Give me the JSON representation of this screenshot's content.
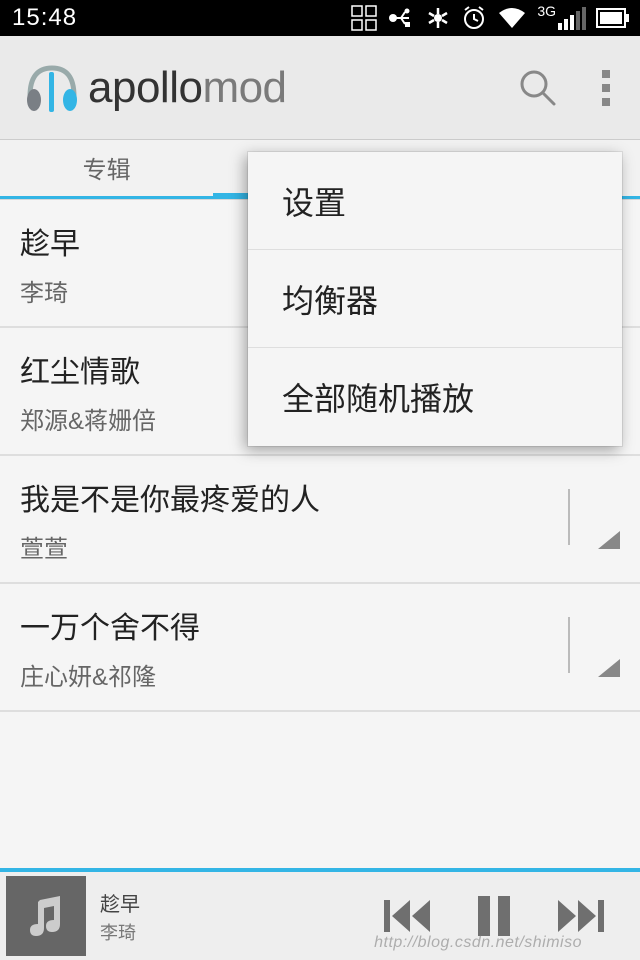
{
  "status_bar": {
    "time": "15:48",
    "network_label": "3G"
  },
  "app_bar": {
    "logo_main": "apollo",
    "logo_sub": "mod"
  },
  "tabs": {
    "left": "专辑"
  },
  "menu": {
    "items": [
      "设置",
      "均衡器",
      "全部随机播放"
    ]
  },
  "songs": [
    {
      "title": "趁早",
      "artist": "李琦"
    },
    {
      "title": "红尘情歌",
      "artist": "郑源&蒋姗倍"
    },
    {
      "title": "我是不是你最疼爱的人",
      "artist": "萱萱"
    },
    {
      "title": "一万个舍不得",
      "artist": "庄心妍&祁隆"
    }
  ],
  "player": {
    "title": "趁早",
    "artist": "李琦"
  },
  "watermark": "http://blog.csdn.net/shimiso"
}
